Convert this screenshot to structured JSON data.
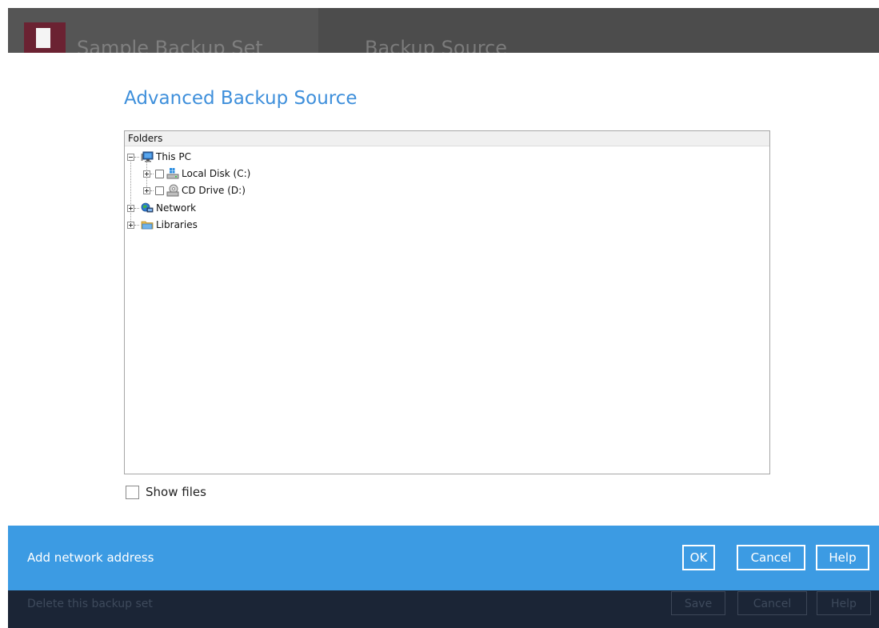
{
  "background": {
    "title": "Sample Backup Set",
    "subtitle": "Backup Source",
    "footer_link": "Delete this backup set",
    "footer_buttons": {
      "save": "Save",
      "cancel": "Cancel",
      "help": "Help"
    }
  },
  "dialog": {
    "title": "Advanced Backup Source",
    "tree": {
      "header": "Folders",
      "items": [
        {
          "label": "This PC",
          "icon": "computer-icon"
        },
        {
          "label": "Local Disk (C:)",
          "icon": "local-disk-icon"
        },
        {
          "label": "CD Drive (D:)",
          "icon": "cd-drive-icon"
        },
        {
          "label": "Network",
          "icon": "network-icon"
        },
        {
          "label": "Libraries",
          "icon": "libraries-icon"
        }
      ]
    },
    "show_files_label": "Show files",
    "add_network_label": "Add network address",
    "buttons": {
      "ok": "OK",
      "cancel": "Cancel",
      "help": "Help"
    }
  },
  "colors": {
    "accent": "#3c9be3",
    "title_blue": "#3e8fdb",
    "app_icon": "#6b2232",
    "footer_dark": "#1b2536"
  }
}
